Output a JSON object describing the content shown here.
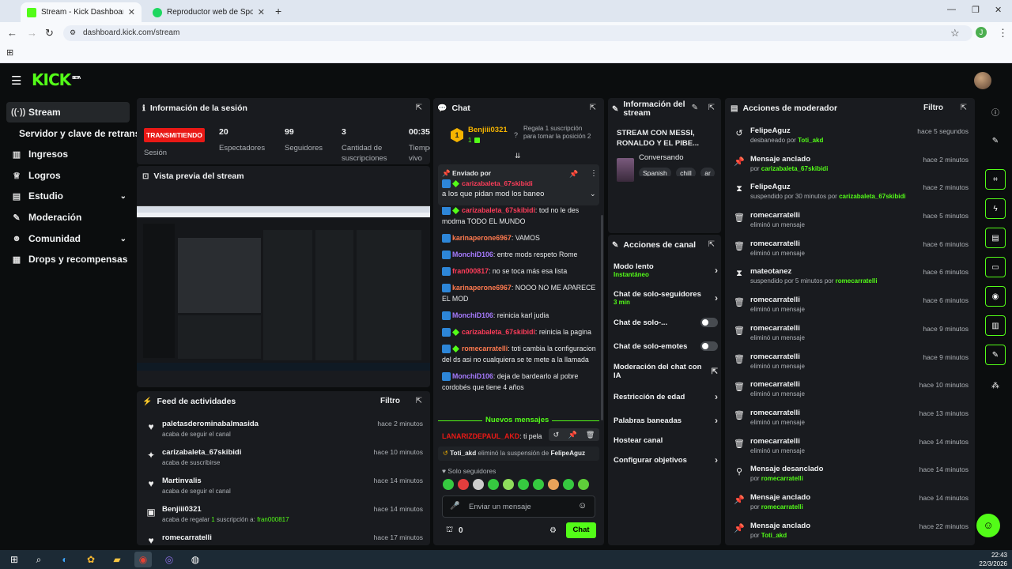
{
  "browser": {
    "tabs": [
      {
        "title": "Stream - Kick Dashboard",
        "active": true
      },
      {
        "title": "Reproductor web de Spotify: m",
        "active": false
      }
    ],
    "url": "dashboard.kick.com/stream",
    "profile_initial": "J"
  },
  "sidebar": {
    "items": [
      {
        "label": "Stream",
        "icon": "broadcast-icon",
        "selected": true
      },
      {
        "label": "Servidor y clave de retransm",
        "icon": "",
        "selected": false
      },
      {
        "label": "Ingresos",
        "icon": "chart-icon",
        "selected": false
      },
      {
        "label": "Logros",
        "icon": "trophy-icon",
        "selected": false
      },
      {
        "label": "Estudio",
        "icon": "studio-icon",
        "selected": false,
        "chevron": true
      },
      {
        "label": "Moderación",
        "icon": "wrench-icon",
        "selected": false
      },
      {
        "label": "Comunidad",
        "icon": "people-icon",
        "selected": false,
        "chevron": true
      },
      {
        "label": "Drops y recompensas",
        "icon": "gift-icon",
        "selected": false
      }
    ]
  },
  "session": {
    "title": "Información de la sesión",
    "live_label": "TRANSMITIENDO",
    "session_label": "Sesión",
    "stats": [
      {
        "value": "20",
        "label": "Espectadores"
      },
      {
        "value": "99",
        "label": "Seguidores"
      },
      {
        "value": "3",
        "label": "Cantidad de suscripciones"
      },
      {
        "value": "00:35",
        "label": "Tiempo en vivo"
      }
    ]
  },
  "preview": {
    "title": "Vista previa del stream"
  },
  "feed": {
    "title": "Feed de actividades",
    "filter": "Filtro",
    "items": [
      {
        "icon": "heart-icon",
        "name": "paletasderominabalmasida",
        "sub": "acaba de seguir el canal",
        "time": "hace 2 minutos"
      },
      {
        "icon": "sparkle-icon",
        "name": "carizabaleta_67skibidi",
        "sub": "acaba de suscribirse",
        "time": "hace 10 minutos"
      },
      {
        "icon": "heart-icon",
        "name": "Martinvalis",
        "sub": "acaba de seguir el canal",
        "time": "hace 14 minutos"
      },
      {
        "icon": "gift-icon",
        "name": "Benjiii0321",
        "sub_a": "acaba de regalar ",
        "sub_b": "1",
        "sub_c": " suscripción a: ",
        "sub_d": "fran000817",
        "time": "hace 14 minutos"
      },
      {
        "icon": "heart-icon",
        "name": "romecarratelli",
        "sub": "",
        "time": "hace 17 minutos"
      }
    ]
  },
  "chat": {
    "title": "Chat",
    "gifter": {
      "name": "Benjiii0321",
      "count": "1",
      "rank": "1",
      "text": "Regala 1 suscripción para tomar la posición 2"
    },
    "pinned": {
      "label": "Enviado por",
      "user": "carizabaleta_67skibidi",
      "text": "a los que pidan mod los baneo"
    },
    "messages": [
      {
        "user": "carizabaleta_67skibidi",
        "color": "#ff3d5a",
        "badges": 2,
        "text": "tod no le des modma TODO EL MUNDO"
      },
      {
        "user": "karinaperone6967",
        "color": "#ff7a4f",
        "badges": 1,
        "text": "VAMOS"
      },
      {
        "user": "MonchiD106",
        "color": "#a77bff",
        "badges": 1,
        "text": "entre mods respeto Rome"
      },
      {
        "user": "fran000817",
        "color": "#ff3d5a",
        "badges": 1,
        "text": "no se toca más esa lista"
      },
      {
        "user": "karinaperone6967",
        "color": "#ff7a4f",
        "badges": 1,
        "text": "NOOO NO ME APARECE EL MOD"
      },
      {
        "user": "MonchiD106",
        "color": "#a77bff",
        "badges": 1,
        "text": "reinicia karl judia"
      },
      {
        "user": "carizabaleta_67skibidi",
        "color": "#ff3d5a",
        "badges": 2,
        "text": "reinicia la pagina"
      },
      {
        "user": "romecarratelli",
        "color": "#ff7a4f",
        "badges": 2,
        "text": "toti cambia la configuracion del ds asi no cualquiera se te mete a la llamada"
      },
      {
        "user": "MonchiD106",
        "color": "#a77bff",
        "badges": 1,
        "text": "deja de bardearlo al pobre cordobés que tiene 4 años"
      }
    ],
    "new_messages": "Nuevos mensajes",
    "last_message": {
      "user": "LANARIZDEPAUL_AKD",
      "text": "ti pela"
    },
    "system_msg": {
      "user": "Toti_akd",
      "action": "eliminó la suspensión de",
      "target": "FelipeAguz"
    },
    "followers_only": "Solo seguidores",
    "input_placeholder": "Enviar un mensaje",
    "points": "0",
    "send": "Chat"
  },
  "stream_info": {
    "title": "Información del stream",
    "stream_title": "STREAM CON MESSI, RONALDO Y EL PIBE...",
    "category": "Conversando",
    "tags": [
      "Spanish",
      "chill",
      "ar"
    ]
  },
  "channel_actions": {
    "title": "Acciones de canal",
    "items": [
      {
        "label": "Modo lento",
        "sub": "Instantáneo",
        "control": "arrow"
      },
      {
        "label": "Chat de solo-seguidores",
        "sub": "3 min",
        "control": "arrow"
      },
      {
        "label": "Chat de solo-...",
        "sub": "",
        "control": "toggle"
      },
      {
        "label": "Chat de solo-emotes",
        "sub": "",
        "control": "toggle"
      },
      {
        "label": "Moderación del chat con IA",
        "sub": "",
        "control": "external"
      },
      {
        "label": "Restricción de edad",
        "sub": "",
        "control": "arrow"
      },
      {
        "label": "Palabras baneadas",
        "sub": "",
        "control": "arrow"
      },
      {
        "label": "Hostear canal",
        "sub": "",
        "control": "none"
      },
      {
        "label": "Configurar objetivos",
        "sub": "",
        "control": "arrow"
      }
    ]
  },
  "mod_actions": {
    "title": "Acciones de moderador",
    "filter": "Filtro",
    "items": [
      {
        "icon": "unban-icon",
        "name": "FelipeAguz",
        "pre": "desbaneado por ",
        "by": "Toti_akd",
        "time": "hace 5 segundos"
      },
      {
        "icon": "pin-icon",
        "name": "Mensaje anclado",
        "pre": "por ",
        "by": "carizabaleta_67skibidi",
        "time": "hace 2 minutos"
      },
      {
        "icon": "hourglass-icon",
        "name": "FelipeAguz",
        "pre": "suspendido por 30 minutos por ",
        "by": "carizabaleta_67skibidi",
        "time": "hace 2 minutos"
      },
      {
        "icon": "trash-icon",
        "name": "romecarratelli",
        "pre": "eliminó un mensaje",
        "by": "",
        "time": "hace 5 minutos"
      },
      {
        "icon": "trash-icon",
        "name": "romecarratelli",
        "pre": "eliminó un mensaje",
        "by": "",
        "time": "hace 6 minutos"
      },
      {
        "icon": "hourglass-icon",
        "name": "mateotanez",
        "pre": "suspendido por 5 minutos por ",
        "by": "romecarratelli",
        "time": "hace 6 minutos"
      },
      {
        "icon": "trash-icon",
        "name": "romecarratelli",
        "pre": "eliminó un mensaje",
        "by": "",
        "time": "hace 6 minutos"
      },
      {
        "icon": "trash-icon",
        "name": "romecarratelli",
        "pre": "eliminó un mensaje",
        "by": "",
        "time": "hace 9 minutos"
      },
      {
        "icon": "trash-icon",
        "name": "romecarratelli",
        "pre": "eliminó un mensaje",
        "by": "",
        "time": "hace 9 minutos"
      },
      {
        "icon": "trash-icon",
        "name": "romecarratelli",
        "pre": "eliminó un mensaje",
        "by": "",
        "time": "hace 10 minutos"
      },
      {
        "icon": "trash-icon",
        "name": "romecarratelli",
        "pre": "eliminó un mensaje",
        "by": "",
        "time": "hace 13 minutos"
      },
      {
        "icon": "trash-icon",
        "name": "romecarratelli",
        "pre": "eliminó un mensaje",
        "by": "",
        "time": "hace 14 minutos"
      },
      {
        "icon": "unpin-icon",
        "name": "Mensaje desanclado",
        "pre": "por ",
        "by": "romecarratelli",
        "time": "hace 14 minutos"
      },
      {
        "icon": "pin-icon",
        "name": "Mensaje anclado",
        "pre": "por ",
        "by": "romecarratelli",
        "time": "hace 14 minutos"
      },
      {
        "icon": "pin-icon",
        "name": "Mensaje anclado",
        "pre": "por ",
        "by": "Toti_akd",
        "time": "hace 22 minutos"
      }
    ]
  },
  "taskbar": {
    "time": "22:43",
    "date": "22/3/2026"
  },
  "colors": {
    "brand": "#53fc18",
    "panel": "#191b1f",
    "background": "#0b0d0e",
    "live": "#e91916"
  }
}
